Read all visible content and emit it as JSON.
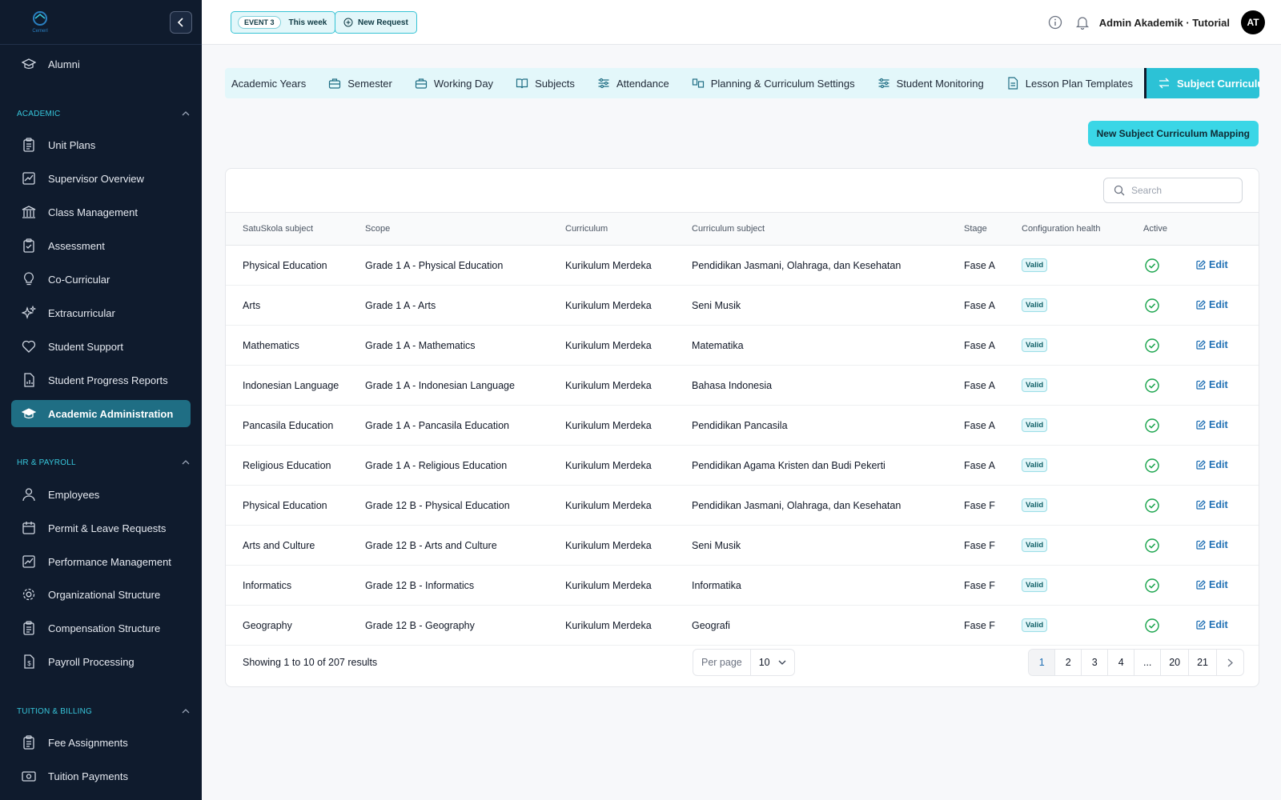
{
  "sidebar": {
    "logo_text": "Cemerl",
    "items_top": [
      {
        "label": "Alumni",
        "icon": "graduation-cap-icon"
      }
    ],
    "sections": [
      {
        "title": "ACADEMIC",
        "items": [
          {
            "label": "Unit Plans",
            "icon": "clipboard-icon"
          },
          {
            "label": "Supervisor Overview",
            "icon": "chart-icon"
          },
          {
            "label": "Class Management",
            "icon": "building-icon"
          },
          {
            "label": "Assessment",
            "icon": "clipboard-check-icon"
          },
          {
            "label": "Co-Curricular",
            "icon": "lightbulb-icon"
          },
          {
            "label": "Extracurricular",
            "icon": "sparkles-icon"
          },
          {
            "label": "Student Support",
            "icon": "heart-icon"
          },
          {
            "label": "Student Progress Reports",
            "icon": "report-icon"
          },
          {
            "label": "Academic Administration",
            "icon": "graduation-cap-icon",
            "active": true
          }
        ]
      },
      {
        "title": "HR & PAYROLL",
        "items": [
          {
            "label": "Employees",
            "icon": "user-icon"
          },
          {
            "label": "Permit & Leave Requests",
            "icon": "calendar-icon"
          },
          {
            "label": "Performance Management",
            "icon": "chart-icon"
          },
          {
            "label": "Organizational Structure",
            "icon": "gear-icon"
          },
          {
            "label": "Compensation Structure",
            "icon": "clipboard-icon"
          },
          {
            "label": "Payroll Processing",
            "icon": "dollar-file-icon"
          }
        ]
      },
      {
        "title": "TUITION & BILLING",
        "items": [
          {
            "label": "Fee Assignments",
            "icon": "clipboard-icon"
          },
          {
            "label": "Tuition Payments",
            "icon": "money-icon"
          }
        ]
      }
    ]
  },
  "topbar": {
    "event_badge": "EVENT 3",
    "event_label": "This week",
    "new_request": "New Request",
    "user_name": "Admin Akademik · Tutorial",
    "avatar_initials": "AT"
  },
  "tabs": [
    {
      "label": "Academic Years",
      "icon": ""
    },
    {
      "label": "Semester",
      "icon": "briefcase-icon"
    },
    {
      "label": "Working Day",
      "icon": "briefcase-icon"
    },
    {
      "label": "Subjects",
      "icon": "book-icon"
    },
    {
      "label": "Attendance",
      "icon": "sliders-icon"
    },
    {
      "label": "Planning & Curriculum Settings",
      "icon": "layout-icon"
    },
    {
      "label": "Student Monitoring",
      "icon": "sliders-icon"
    },
    {
      "label": "Lesson Plan Templates",
      "icon": "file-icon"
    },
    {
      "label": "Subject Curriculum Mapping",
      "icon": "swap-icon",
      "active": true
    }
  ],
  "actions": {
    "new_mapping": "New Subject Curriculum Mapping",
    "search_placeholder": "Search"
  },
  "table": {
    "columns": [
      "SatuSkola subject",
      "Scope",
      "Curriculum",
      "Curriculum subject",
      "Stage",
      "Configuration health",
      "Active"
    ],
    "rows": [
      [
        "Physical Education",
        "Grade 1 A - Physical Education",
        "Kurikulum Merdeka",
        "Pendidikan Jasmani, Olahraga, dan Kesehatan",
        "Fase A",
        "Valid"
      ],
      [
        "Arts",
        "Grade 1 A - Arts",
        "Kurikulum Merdeka",
        "Seni Musik",
        "Fase A",
        "Valid"
      ],
      [
        "Mathematics",
        "Grade 1 A - Mathematics",
        "Kurikulum Merdeka",
        "Matematika",
        "Fase A",
        "Valid"
      ],
      [
        "Indonesian Language",
        "Grade 1 A - Indonesian Language",
        "Kurikulum Merdeka",
        "Bahasa Indonesia",
        "Fase A",
        "Valid"
      ],
      [
        "Pancasila Education",
        "Grade 1 A - Pancasila Education",
        "Kurikulum Merdeka",
        "Pendidikan Pancasila",
        "Fase A",
        "Valid"
      ],
      [
        "Religious Education",
        "Grade 1 A - Religious Education",
        "Kurikulum Merdeka",
        "Pendidikan Agama Kristen dan Budi Pekerti",
        "Fase A",
        "Valid"
      ],
      [
        "Physical Education",
        "Grade 12 B - Physical Education",
        "Kurikulum Merdeka",
        "Pendidikan Jasmani, Olahraga, dan Kesehatan",
        "Fase F",
        "Valid"
      ],
      [
        "Arts and Culture",
        "Grade 12 B - Arts and Culture",
        "Kurikulum Merdeka",
        "Seni Musik",
        "Fase F",
        "Valid"
      ],
      [
        "Informatics",
        "Grade 12 B - Informatics",
        "Kurikulum Merdeka",
        "Informatika",
        "Fase F",
        "Valid"
      ],
      [
        "Geography",
        "Grade 12 B - Geography",
        "Kurikulum Merdeka",
        "Geografi",
        "Fase F",
        "Valid"
      ]
    ],
    "edit_label": "Edit"
  },
  "footer": {
    "showing": "Showing 1 to 10 of 207 results",
    "per_page_label": "Per page",
    "per_page_value": "10",
    "pages": [
      "1",
      "2",
      "3",
      "4",
      "...",
      "20",
      "21"
    ],
    "current_page": "1"
  },
  "colors": {
    "sidebar_bg": "#0f1b2d",
    "accent": "#2cc2d6",
    "active_item": "#1f6e84",
    "link": "#1e6fb4",
    "success": "#16a34a"
  }
}
